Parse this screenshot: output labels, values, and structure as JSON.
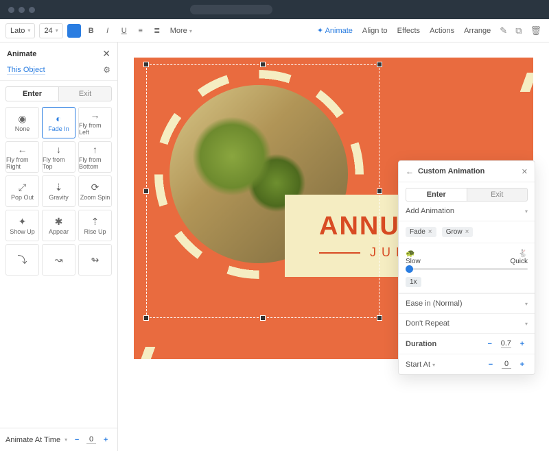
{
  "toolbar": {
    "font": "Lato",
    "size": "24",
    "more": "More",
    "animate": "Animate",
    "alignto": "Align to",
    "effects": "Effects",
    "actions": "Actions",
    "arrange": "Arrange"
  },
  "side": {
    "title": "Animate",
    "object": "This Object",
    "tab_enter": "Enter",
    "tab_exit": "Exit",
    "items": [
      {
        "label": "None"
      },
      {
        "label": "Fade In"
      },
      {
        "label": "Fly from Left"
      },
      {
        "label": "Fly from Right"
      },
      {
        "label": "Fly from Top"
      },
      {
        "label": "Fly from Bottom"
      },
      {
        "label": "Pop Out"
      },
      {
        "label": "Gravity"
      },
      {
        "label": "Zoom Spin"
      },
      {
        "label": "Show Up"
      },
      {
        "label": "Appear"
      },
      {
        "label": "Rise Up"
      }
    ],
    "time_label": "Animate At Time",
    "time_value": "0"
  },
  "design": {
    "headline": "ANNUAL F",
    "subline": "JUNE"
  },
  "panel": {
    "title": "Custom Animation",
    "tab_enter": "Enter",
    "tab_exit": "Exit",
    "add": "Add Animation",
    "chips": [
      "Fade",
      "Grow"
    ],
    "speed_slow": "Slow",
    "speed_quick": "Quick",
    "multiplier": "1x",
    "easing": "Ease in (Normal)",
    "repeat": "Don't Repeat",
    "dur_label": "Duration",
    "dur_value": "0.7",
    "start_label": "Start At",
    "start_value": "0"
  }
}
